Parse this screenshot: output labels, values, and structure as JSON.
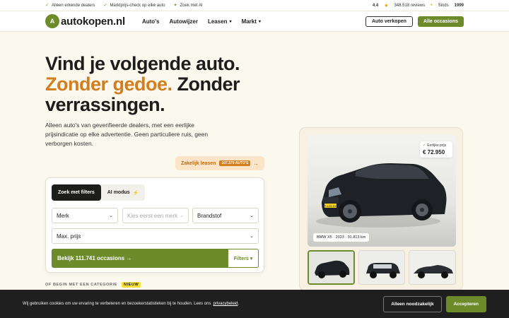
{
  "topbar": {
    "usps": [
      "Alleen erkende dealers",
      "Marktprijs-check op elke auto",
      "Zoek met AI"
    ],
    "rating": "4.4",
    "reviews": "348.518 reviews",
    "since_label": "Sinds",
    "since_year": "1999"
  },
  "header": {
    "logo_mark": "A",
    "logo_text": "autokopen.nl",
    "nav": [
      "Auto's",
      "Autowijzer",
      "Leasen",
      "Markt"
    ],
    "sell_label": "Auto verkopen",
    "all_label": "Alle occasions"
  },
  "hero": {
    "line1": "Vind je volgende auto.",
    "line2_accent": "Zonder gedoe.",
    "line2_rest": " Zonder",
    "line3": "verrassingen.",
    "subtitle": "Alleen auto's van geverifieerde dealers, met een eerlijke prijsindicatie op elke advertentie. Geen particuliere ruis, geen verborgen kosten."
  },
  "lease": {
    "label": "Zakelijk leasen",
    "count": "107.379 AUTO'S",
    "arrow": "→"
  },
  "search": {
    "tab_filters": "Zoek met filters",
    "tab_ai": "AI modus",
    "merk": "Merk",
    "model_placeholder": "Kies eerst een merk",
    "brandstof": "Brandstof",
    "max_prijs": "Max. prijs",
    "cta": "Bekijk 111.741 occasions →",
    "filters": "Filters ▾"
  },
  "category": {
    "label": "OF BEGIN MET EEN CATEGORIE",
    "badge": "NIEUW"
  },
  "car": {
    "fair_label": "Eerlijke prijs",
    "price": "€ 72.950",
    "caption": "BMW X5 · 2023 · 91.813 km",
    "plate": "T-123-XX"
  },
  "cookie": {
    "text": "Wij gebruiken cookies om uw ervaring te verbeteren en bezoekerstatistieken bij te houden. Lees ons",
    "link": "privacybeleid",
    "necessary": "Alleen noodzakelijk",
    "accept": "Accepteren"
  },
  "colors": {
    "brand_green": "#6d8b2a",
    "accent_orange": "#d27e1f",
    "background": "#fbf8ee"
  }
}
